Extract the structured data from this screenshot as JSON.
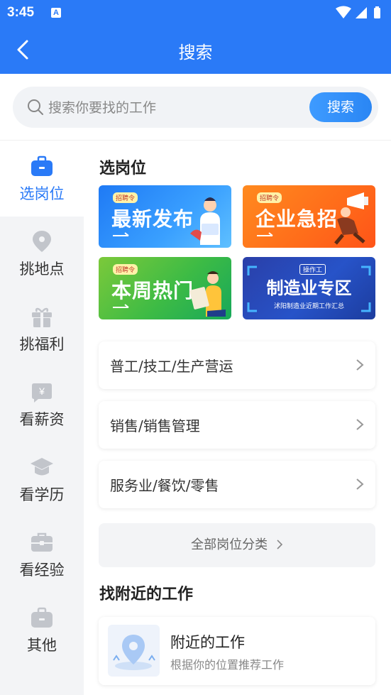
{
  "status": {
    "time": "3:45",
    "a_badge": "A"
  },
  "header": {
    "title": "搜索"
  },
  "search": {
    "placeholder": "搜索你要找的工作",
    "button": "搜索"
  },
  "sidebar": {
    "items": [
      {
        "label": "选岗位",
        "icon": "briefcase-icon",
        "active": true
      },
      {
        "label": "挑地点",
        "icon": "location-pin-icon",
        "active": false
      },
      {
        "label": "挑福利",
        "icon": "gift-icon",
        "active": false
      },
      {
        "label": "看薪资",
        "icon": "yen-icon",
        "active": false
      },
      {
        "label": "看学历",
        "icon": "graduation-cap-icon",
        "active": false
      },
      {
        "label": "看经验",
        "icon": "toolbox-icon",
        "active": false
      },
      {
        "label": "其他",
        "icon": "bag-icon",
        "active": false
      }
    ]
  },
  "main": {
    "section1_title": "选岗位",
    "banners": [
      {
        "tag": "招聘令",
        "text": "最新发布",
        "color": "#2f7cf6"
      },
      {
        "tag": "招聘令",
        "text": "企业急招",
        "color": "#f7731e"
      },
      {
        "tag": "招聘令",
        "text": "本周热门",
        "color": "#3fb94a"
      },
      {
        "tag": "操作工",
        "text": "制造业专区",
        "sub": "沭阳制造业近期工作汇总",
        "color": "#2747b8"
      }
    ],
    "categories": [
      {
        "label": "普工/技工/生产营运"
      },
      {
        "label": "销售/销售管理"
      },
      {
        "label": "服务业/餐饮/零售"
      }
    ],
    "all_categories": "全部岗位分类",
    "section2_title": "找附近的工作",
    "nearby": {
      "title": "附近的工作",
      "subtitle": "根据你的位置推荐工作"
    }
  }
}
